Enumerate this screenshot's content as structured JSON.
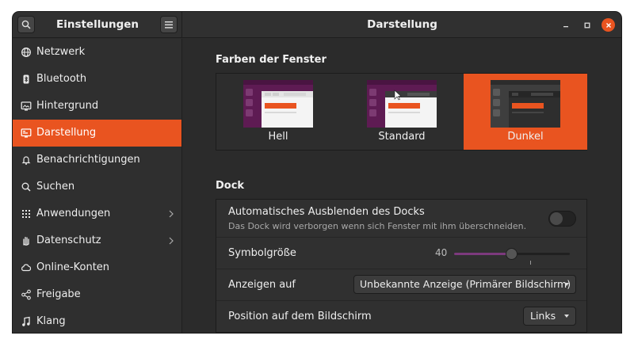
{
  "header": {
    "app_title": "Einstellungen",
    "page_title": "Darstellung",
    "search_icon": "search-icon",
    "menu_icon": "hamburger-menu-icon",
    "minimize_label": "–",
    "maximize_label": "□",
    "close_label": "✕"
  },
  "sidebar": {
    "items": [
      {
        "label": "Netzwerk",
        "icon": "network-icon"
      },
      {
        "label": "Bluetooth",
        "icon": "bluetooth-icon"
      },
      {
        "label": "Hintergrund",
        "icon": "background-icon"
      },
      {
        "label": "Darstellung",
        "icon": "appearance-icon",
        "active": true
      },
      {
        "label": "Benachrichtigungen",
        "icon": "bell-icon"
      },
      {
        "label": "Suchen",
        "icon": "search-icon"
      },
      {
        "label": "Anwendungen",
        "icon": "apps-grid-icon",
        "chevron": true
      },
      {
        "label": "Datenschutz",
        "icon": "hand-icon",
        "chevron": true
      },
      {
        "label": "Online-Konten",
        "icon": "cloud-icon"
      },
      {
        "label": "Freigabe",
        "icon": "share-icon"
      },
      {
        "label": "Klang",
        "icon": "music-note-icon"
      }
    ]
  },
  "main": {
    "themes_title": "Farben der Fenster",
    "themes": [
      {
        "label": "Hell",
        "selected": false
      },
      {
        "label": "Standard",
        "selected": false
      },
      {
        "label": "Dunkel",
        "selected": true
      }
    ],
    "dock_title": "Dock",
    "dock": {
      "autohide_label": "Automatisches Ausblenden des Docks",
      "autohide_sub": "Das Dock wird verborgen wenn sich Fenster mit ihm überschneiden.",
      "autohide_on": false,
      "icon_size_label": "Symbolgröße",
      "icon_size_value": "40",
      "icon_size_fraction": 0.5,
      "show_on_label": "Anzeigen auf",
      "show_on_value": "Unbekannte Anzeige (Primärer Bildschirm)",
      "position_label": "Position auf dem Bildschirm",
      "position_value": "Links"
    }
  },
  "colors": {
    "accent": "#e95420",
    "aubergine": "#77216f",
    "slider_fill": "#7c3a7d"
  }
}
